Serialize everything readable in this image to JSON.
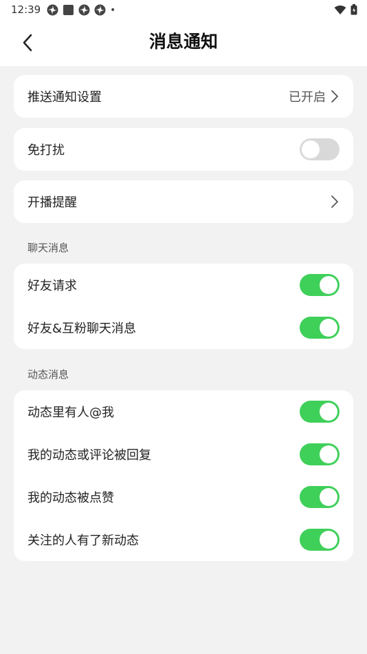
{
  "status_bar": {
    "time": "12:39",
    "dot": "•",
    "icons": [
      "pinwheel-icon",
      "square-app-icon",
      "pinwheel-icon",
      "pinwheel-icon"
    ],
    "right_icons": [
      "wifi-icon",
      "battery-icon"
    ]
  },
  "header": {
    "title": "消息通知",
    "back_icon": "chevron-left-icon"
  },
  "settings": {
    "push": {
      "label": "推送通知设置",
      "value": "已开启"
    },
    "dnd": {
      "label": "免打扰",
      "enabled": false
    },
    "live": {
      "label": "开播提醒"
    }
  },
  "chat_section": {
    "title": "聊天消息",
    "items": [
      {
        "label": "好友请求",
        "enabled": true
      },
      {
        "label": "好友&互粉聊天消息",
        "enabled": true
      }
    ]
  },
  "feed_section": {
    "title": "动态消息",
    "items": [
      {
        "label": "动态里有人@我",
        "enabled": true
      },
      {
        "label": "我的动态或评论被回复",
        "enabled": true
      },
      {
        "label": "我的动态被点赞",
        "enabled": true
      },
      {
        "label": "关注的人有了新动态",
        "enabled": true
      }
    ]
  },
  "colors": {
    "toggle_on": "#3fd05a",
    "toggle_off": "#d9d9d9",
    "background": "#f2f2f2",
    "card": "#ffffff"
  }
}
